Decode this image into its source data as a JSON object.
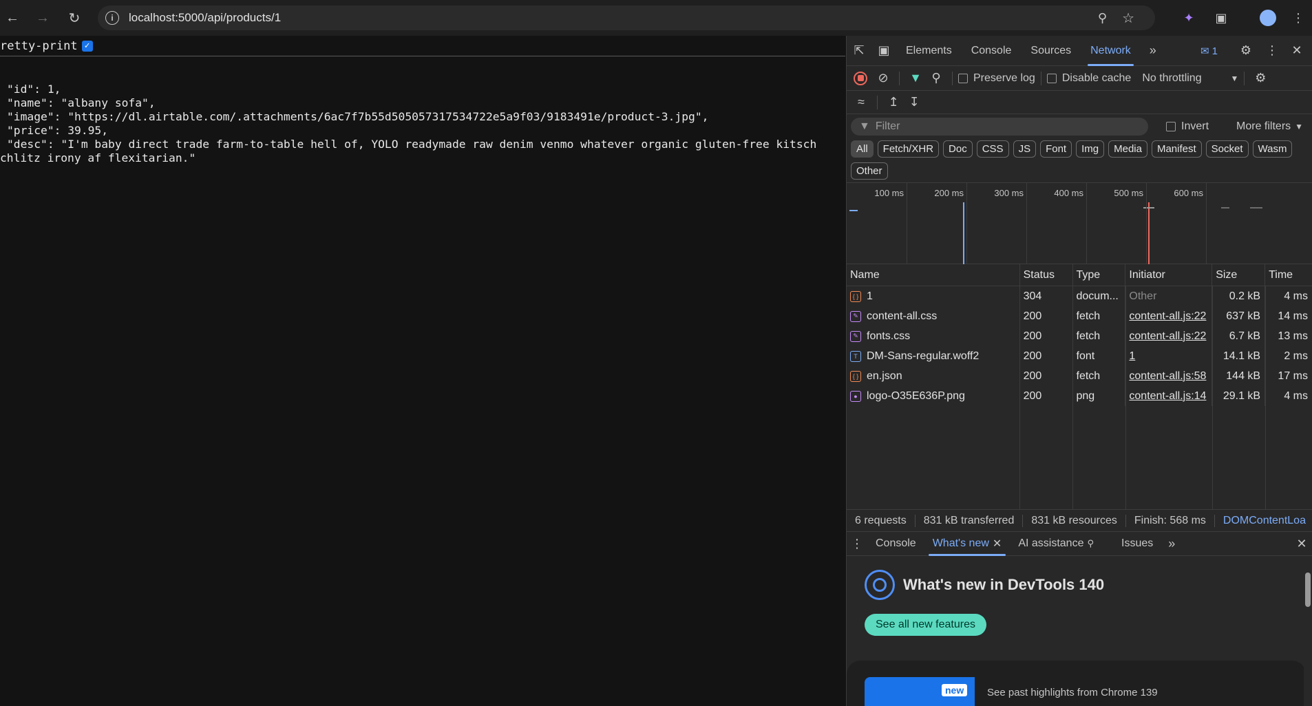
{
  "browser": {
    "url": "localhost:5000/api/products/1"
  },
  "page": {
    "pretty_print_label": "retty-print",
    "pretty_print_checked": true,
    "json_lines": [
      "\"id\": 1,",
      "\"name\": \"albany sofa\",",
      "\"image\": \"https://dl.airtable.com/.attachments/6ac7f7b55d505057317534722e5a9f03/9183491e/product-3.jpg\",",
      "\"price\": 39.95,",
      "\"desc\": \"I'm baby direct trade farm-to-table hell of, YOLO readymade raw denim venmo whatever organic gluten-free kitsch",
      "chlitz irony af flexitarian.\""
    ]
  },
  "devtools": {
    "tabs": [
      "Elements",
      "Console",
      "Sources",
      "Network"
    ],
    "active_tab": "Network",
    "issues_count": "1",
    "toolbar": {
      "preserve_log": "Preserve log",
      "disable_cache": "Disable cache",
      "throttling": "No throttling"
    },
    "filter": {
      "placeholder": "Filter",
      "invert": "Invert",
      "more_filters": "More filters"
    },
    "type_chips": [
      "All",
      "Fetch/XHR",
      "Doc",
      "CSS",
      "JS",
      "Font",
      "Img",
      "Media",
      "Manifest",
      "Socket",
      "Wasm",
      "Other"
    ],
    "overview_ticks": [
      "100 ms",
      "200 ms",
      "300 ms",
      "400 ms",
      "500 ms",
      "600 ms"
    ],
    "columns": [
      "Name",
      "Status",
      "Type",
      "Initiator",
      "Size",
      "Time"
    ],
    "requests": [
      {
        "name": "1",
        "status": "304",
        "type": "docum...",
        "initiator": "Other",
        "size": "0.2 kB",
        "time": "4 ms",
        "icon": "json-icon",
        "icon_color": "#f28b54",
        "initiator_link": false
      },
      {
        "name": "content-all.css",
        "status": "200",
        "type": "fetch",
        "initiator": "content-all.js:22",
        "size": "637 kB",
        "time": "14 ms",
        "icon": "css-icon",
        "icon_color": "#c58af9",
        "initiator_link": true
      },
      {
        "name": "fonts.css",
        "status": "200",
        "type": "fetch",
        "initiator": "content-all.js:22",
        "size": "6.7 kB",
        "time": "13 ms",
        "icon": "css-icon",
        "icon_color": "#c58af9",
        "initiator_link": true
      },
      {
        "name": "DM-Sans-regular.woff2",
        "status": "200",
        "type": "font",
        "initiator": "1",
        "size": "14.1 kB",
        "time": "2 ms",
        "icon": "font-icon",
        "icon_color": "#7cacf8",
        "initiator_link": true
      },
      {
        "name": "en.json",
        "status": "200",
        "type": "fetch",
        "initiator": "content-all.js:58",
        "size": "144 kB",
        "time": "17 ms",
        "icon": "json-icon",
        "icon_color": "#f28b54",
        "initiator_link": true
      },
      {
        "name": "logo-O35E636P.png",
        "status": "200",
        "type": "png",
        "initiator": "content-all.js:14",
        "size": "29.1 kB",
        "time": "4 ms",
        "icon": "image-icon",
        "icon_color": "#c58af9",
        "initiator_link": true
      }
    ],
    "summary": {
      "requests": "6 requests",
      "transferred": "831 kB transferred",
      "resources": "831 kB resources",
      "finish": "Finish: 568 ms",
      "dom": "DOMContentLoa"
    },
    "drawer": {
      "tabs": [
        "Console",
        "What's new",
        "AI assistance",
        "Issues"
      ],
      "active": "What's new",
      "whats_new_title": "What's new in DevTools 140",
      "see_all_button": "See all new features",
      "card_badge": "new",
      "card_text": "See past highlights from Chrome 139"
    }
  }
}
